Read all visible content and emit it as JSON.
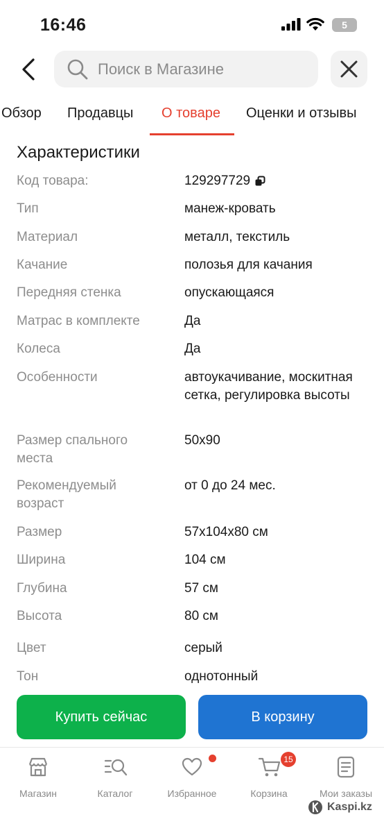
{
  "status_bar": {
    "time": "16:46",
    "battery": "5"
  },
  "header": {
    "search_placeholder": "Поиск в Магазине"
  },
  "tabs": [
    {
      "label": "Обзор"
    },
    {
      "label": "Продавцы"
    },
    {
      "label": "О товаре"
    },
    {
      "label": "Оценки и отзывы"
    }
  ],
  "active_tab": "О товаре",
  "characteristics": {
    "title": "Характеристики",
    "rows": [
      {
        "key": "Код товара:",
        "value": "129297729"
      },
      {
        "key": "Тип",
        "value": "манеж-кровать"
      },
      {
        "key": "Материал",
        "value": "металл, текстиль"
      },
      {
        "key": "Качание",
        "value": "полозья для качания"
      },
      {
        "key": "Передняя стенка",
        "value": "опускающаяся"
      },
      {
        "key": "Матрас в комплекте",
        "value": "Да"
      },
      {
        "key": "Колеса",
        "value": "Да"
      },
      {
        "key": "Особенности",
        "value": "автоукачивание, москитная сетка, регулировка высоты"
      },
      {
        "key": "Размер спального места",
        "value": "50x90"
      },
      {
        "key": "Рекомендуемый возраст",
        "value": "от 0 до 24 мес."
      },
      {
        "key": "Размер",
        "value": "57x104x80 см"
      },
      {
        "key": "Ширина",
        "value": "104 см"
      },
      {
        "key": "Глубина",
        "value": "57 см"
      },
      {
        "key": "Высота",
        "value": "80 см"
      },
      {
        "key": "Цвет",
        "value": "серый"
      },
      {
        "key": "Тон",
        "value": "однотонный"
      }
    ]
  },
  "actions": {
    "buy_now": "Купить сейчас",
    "add_to_cart": "В корзину"
  },
  "bottom_nav": [
    {
      "label": "Магазин",
      "icon": "shop-icon"
    },
    {
      "label": "Каталог",
      "icon": "catalog-search-icon"
    },
    {
      "label": "Избранное",
      "icon": "heart-icon",
      "dot": true
    },
    {
      "label": "Корзина",
      "icon": "cart-icon",
      "badge": "15"
    },
    {
      "label": "Мои заказы",
      "icon": "orders-icon"
    }
  ],
  "watermark": "Kaspi.kz",
  "colors": {
    "accent": "#e5402f",
    "buy": "#0db14b",
    "cart": "#1f74d2"
  }
}
